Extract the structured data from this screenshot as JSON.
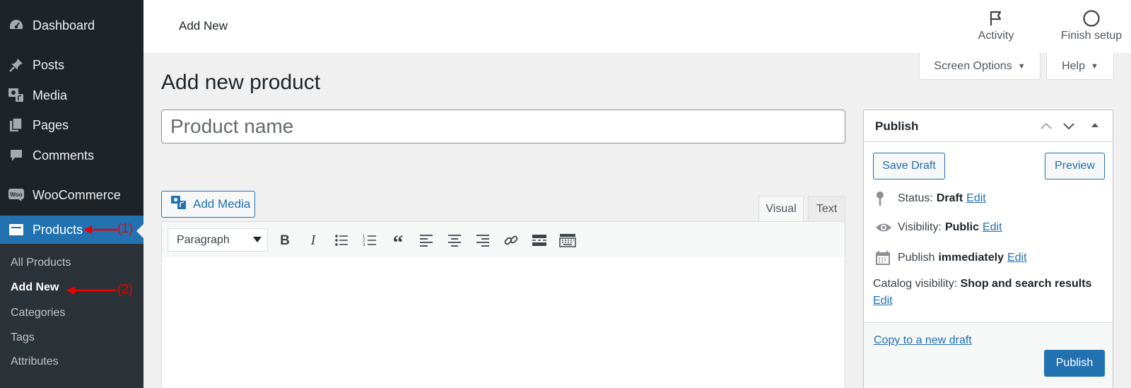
{
  "sidebar": {
    "items": [
      {
        "label": "Dashboard",
        "icon": "dashboard-icon"
      },
      {
        "label": "Posts",
        "icon": "pushpin-icon"
      },
      {
        "label": "Media",
        "icon": "media-icon"
      },
      {
        "label": "Pages",
        "icon": "pages-icon"
      },
      {
        "label": "Comments",
        "icon": "comment-icon"
      },
      {
        "label": "WooCommerce",
        "icon": "woocommerce-icon"
      },
      {
        "label": "Products",
        "icon": "products-icon"
      }
    ],
    "submenu": [
      "All Products",
      "Add New",
      "Categories",
      "Tags",
      "Attributes"
    ]
  },
  "annotations": {
    "first": "(1)",
    "second": "(2)",
    "color": "#ee0000"
  },
  "topbar": {
    "page_label": "Add New",
    "activity": "Activity",
    "finish_setup": "Finish setup"
  },
  "screen_options": "Screen Options",
  "help": "Help",
  "page_title": "Add new product",
  "title_placeholder": "Product name",
  "editor": {
    "add_media": "Add Media",
    "tab_visual": "Visual",
    "tab_text": "Text",
    "format": "Paragraph",
    "toolbar_icons": [
      "bold-icon",
      "italic-icon",
      "bullet-list-icon",
      "numbered-list-icon",
      "blockquote-icon",
      "align-left-icon",
      "align-center-icon",
      "align-right-icon",
      "link-icon",
      "read-more-icon",
      "toolbar-toggle-icon"
    ]
  },
  "publish": {
    "title": "Publish",
    "save_draft": "Save Draft",
    "preview": "Preview",
    "status_label": "Status:",
    "status_value": "Draft",
    "visibility_label": "Visibility:",
    "visibility_value": "Public",
    "publish_label": "Publish",
    "publish_value": "immediately",
    "catalog_label": "Catalog visibility:",
    "catalog_value": "Shop and search results",
    "edit": "Edit",
    "copy_draft": "Copy to a new draft",
    "publish_button": "Publish"
  },
  "colors": {
    "sidebar_bg": "#1d2327",
    "accent": "#2271b1",
    "background": "#f0f0f1"
  }
}
